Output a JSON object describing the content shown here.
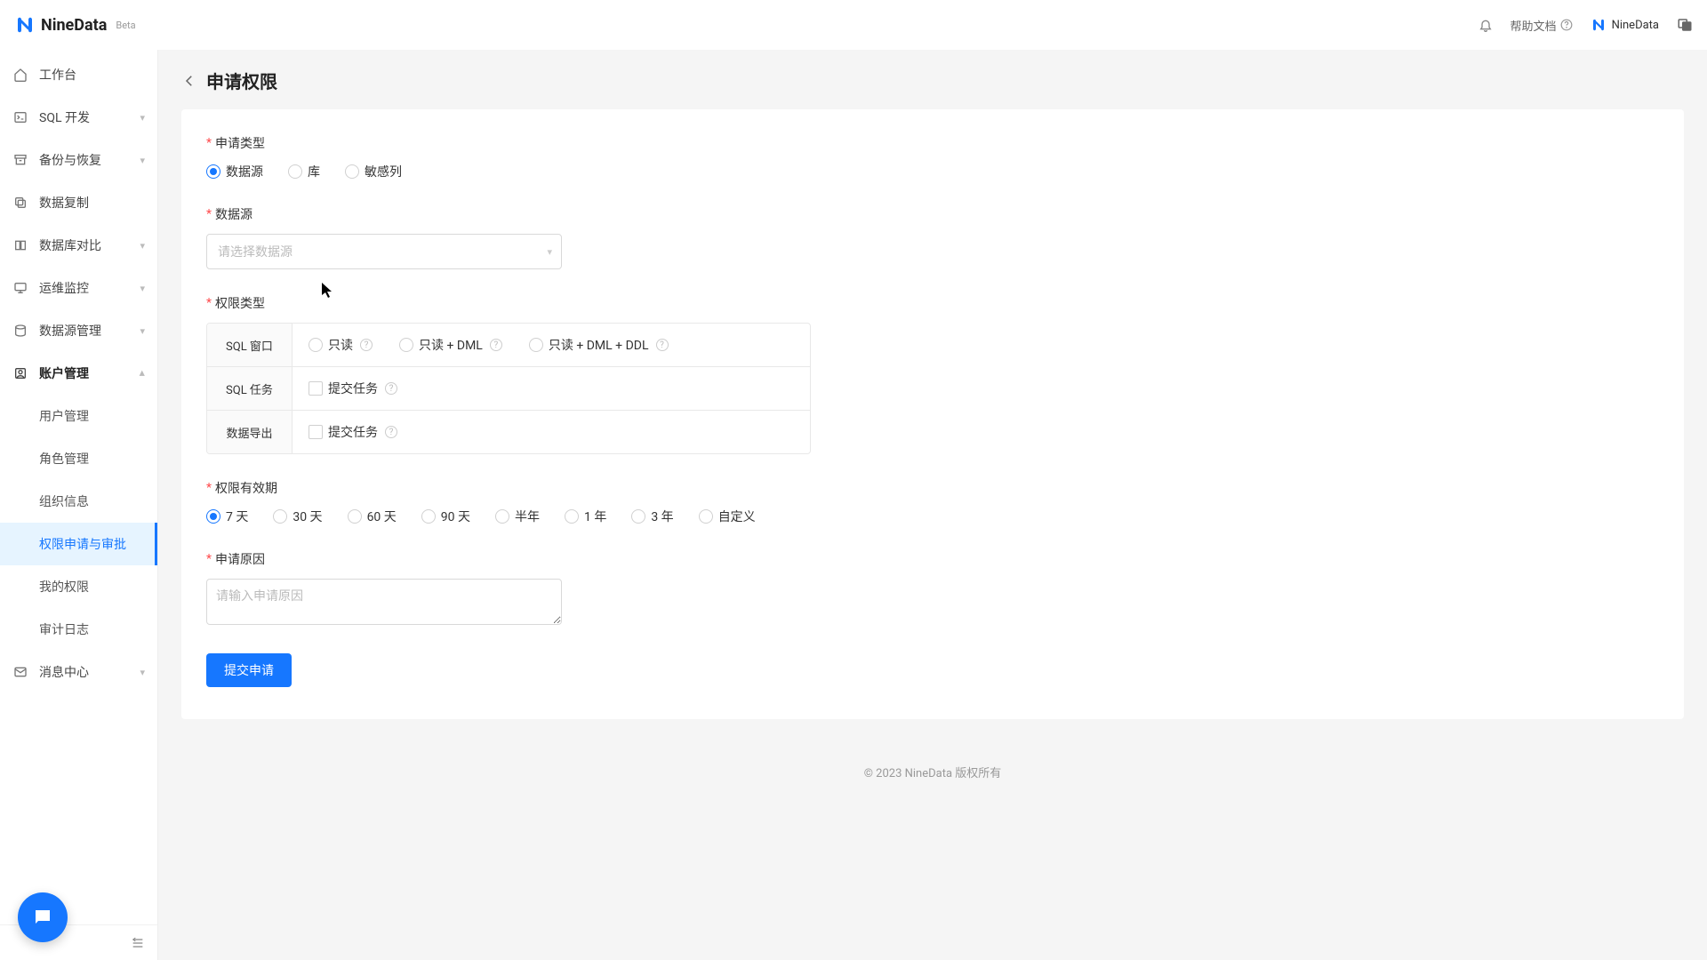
{
  "brand": {
    "name": "NineData",
    "beta": "Beta"
  },
  "header": {
    "help": "帮助文档",
    "user": "NineData"
  },
  "sidebar": {
    "items": [
      {
        "label": "工作台",
        "icon": "home",
        "expandable": false
      },
      {
        "label": "SQL 开发",
        "icon": "terminal",
        "expandable": true
      },
      {
        "label": "备份与恢复",
        "icon": "archive",
        "expandable": true
      },
      {
        "label": "数据复制",
        "icon": "copy",
        "expandable": false
      },
      {
        "label": "数据库对比",
        "icon": "diff",
        "expandable": true
      },
      {
        "label": "运维监控",
        "icon": "monitor",
        "expandable": true
      },
      {
        "label": "数据源管理",
        "icon": "db",
        "expandable": true
      }
    ],
    "account": {
      "label": "账户管理",
      "subs": [
        {
          "label": "用户管理"
        },
        {
          "label": "角色管理"
        },
        {
          "label": "组织信息"
        },
        {
          "label": "权限申请与审批",
          "active": true
        },
        {
          "label": "我的权限"
        },
        {
          "label": "审计日志"
        }
      ]
    },
    "message": {
      "label": "消息中心"
    }
  },
  "page": {
    "title": "申请权限"
  },
  "form": {
    "request_type": {
      "label": "申请类型",
      "options": [
        "数据源",
        "库",
        "敏感列"
      ],
      "selected": 0
    },
    "datasource": {
      "label": "数据源",
      "placeholder": "请选择数据源"
    },
    "perm_type": {
      "label": "权限类型",
      "rows": {
        "sql_window": {
          "head": "SQL 窗口",
          "options": [
            "只读",
            "只读 + DML",
            "只读 + DML + DDL"
          ]
        },
        "sql_task": {
          "head": "SQL 任务",
          "option": "提交任务"
        },
        "data_export": {
          "head": "数据导出",
          "option": "提交任务"
        }
      }
    },
    "validity": {
      "label": "权限有效期",
      "options": [
        "7 天",
        "30 天",
        "60 天",
        "90 天",
        "半年",
        "1 年",
        "3 年",
        "自定义"
      ],
      "selected": 0
    },
    "reason": {
      "label": "申请原因",
      "placeholder": "请输入申请原因"
    },
    "submit": "提交申请"
  },
  "footer": "© 2023 NineData 版权所有"
}
